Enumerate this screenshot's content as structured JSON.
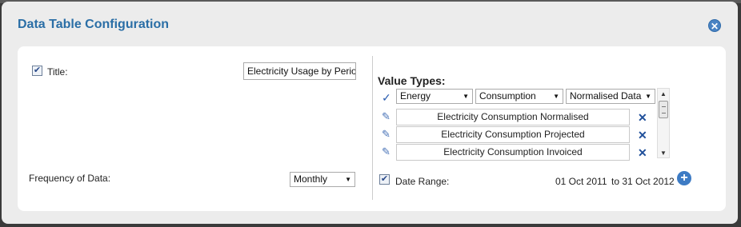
{
  "dialog": {
    "title": "Data Table Configuration",
    "close_icon": "close-circle-icon"
  },
  "left": {
    "title_label": "Title:",
    "title_checked": true,
    "title_value": "Electricity Usage by Perio",
    "frequency_label": "Frequency of Data:",
    "frequency_value": "Monthly"
  },
  "value_types": {
    "heading": "Value Types:",
    "selectors": [
      "Energy",
      "Consumption",
      "Normalised Data"
    ],
    "rows": [
      "Electricity Consumption Normalised",
      "Electricity Consumption Projected",
      "Electricity Consumption Invoiced"
    ]
  },
  "date_range": {
    "label": "Date Range:",
    "checked": true,
    "from": "01 Oct 2011",
    "to_text": "to 31 Oct 2012"
  },
  "colors": {
    "accent": "#2a6ea6",
    "icon_blue": "#3d7bc4"
  }
}
